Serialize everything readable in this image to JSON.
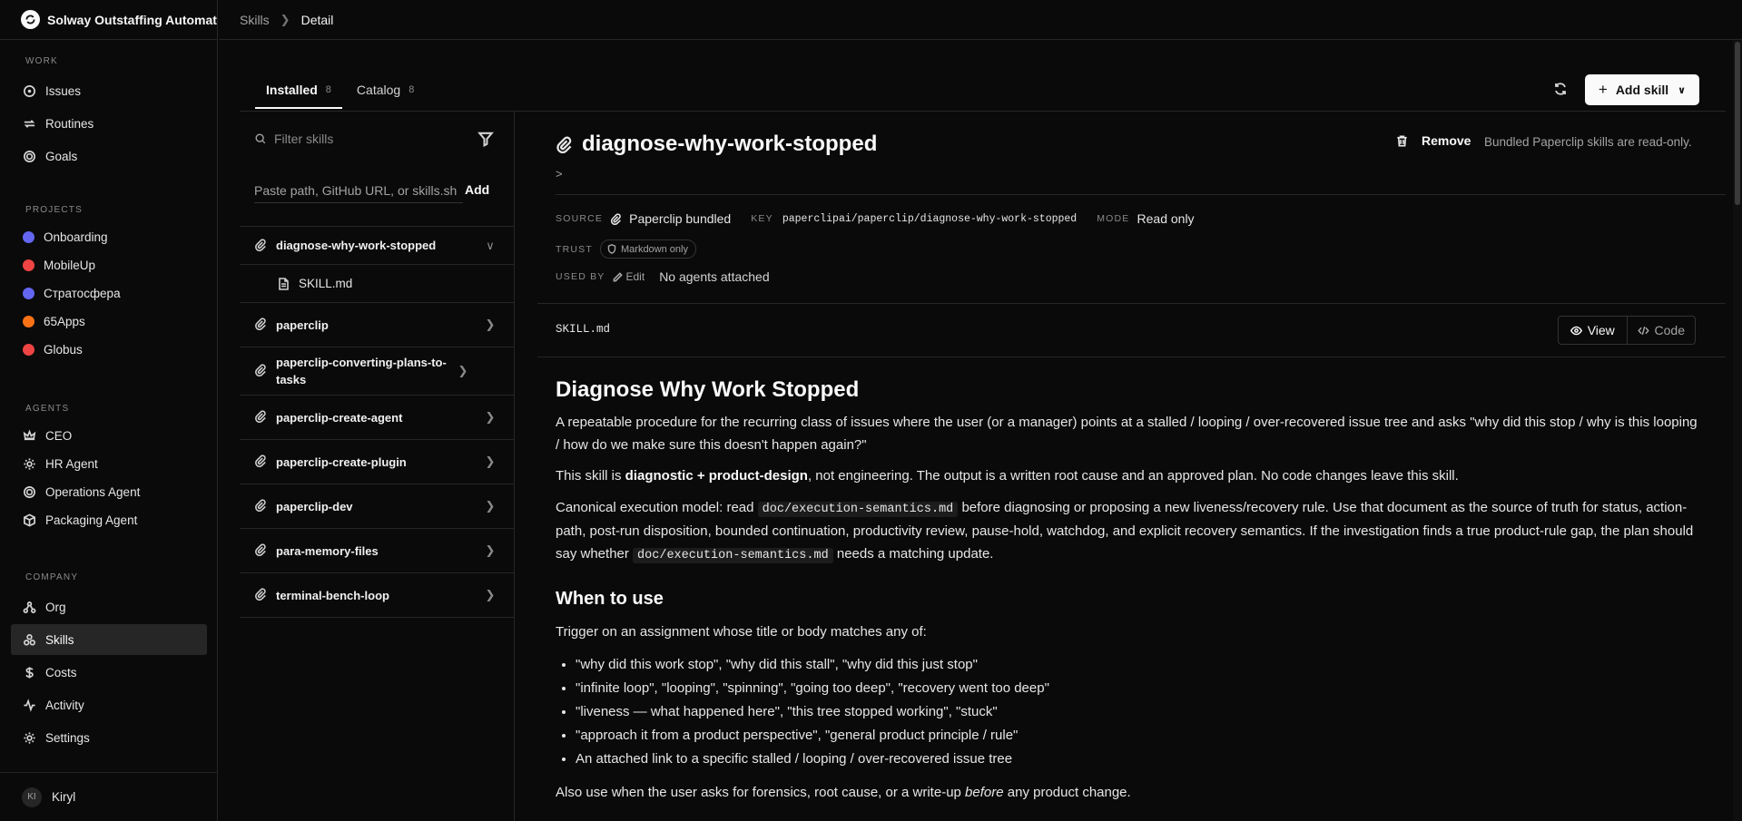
{
  "app": {
    "name": "Solway Outstaffing Automat"
  },
  "breadcrumb": {
    "parent": "Skills",
    "current": "Detail"
  },
  "sidebar": {
    "work_heading": "WORK",
    "work_items": [
      {
        "label": "Issues",
        "icon": "circle-dot-icon"
      },
      {
        "label": "Routines",
        "icon": "repeat-icon"
      },
      {
        "label": "Goals",
        "icon": "target-icon"
      }
    ],
    "projects_heading": "PROJECTS",
    "projects": [
      {
        "label": "Onboarding",
        "color": "#6366f1"
      },
      {
        "label": "MobileUp",
        "color": "#ef4444"
      },
      {
        "label": "Стратосфера",
        "color": "#6366f1"
      },
      {
        "label": "65Apps",
        "color": "#f97316"
      },
      {
        "label": "Globus",
        "color": "#ef4444"
      }
    ],
    "agents_heading": "AGENTS",
    "agents": [
      {
        "label": "CEO",
        "icon": "crown-icon"
      },
      {
        "label": "HR Agent",
        "icon": "cog-icon"
      },
      {
        "label": "Operations Agent",
        "icon": "target-icon"
      },
      {
        "label": "Packaging Agent",
        "icon": "package-icon"
      }
    ],
    "company_heading": "COMPANY",
    "company_items": [
      {
        "label": "Org",
        "icon": "org-icon"
      },
      {
        "label": "Skills",
        "icon": "skills-icon",
        "active": true
      },
      {
        "label": "Costs",
        "icon": "dollar-icon"
      },
      {
        "label": "Activity",
        "icon": "activity-icon"
      },
      {
        "label": "Settings",
        "icon": "gear-icon"
      }
    ],
    "user": {
      "initials": "KI",
      "name": "Kiryl"
    }
  },
  "tabs": [
    {
      "label": "Installed",
      "count": "8",
      "active": true
    },
    {
      "label": "Catalog",
      "count": "8",
      "active": false
    }
  ],
  "toolbar": {
    "add_skill_label": "Add skill"
  },
  "skills_pane": {
    "filter_placeholder": "Filter skills",
    "path_placeholder": "Paste path, GitHub URL, or skills.sh",
    "add_label": "Add",
    "skills": [
      {
        "name": "diagnose-why-work-stopped",
        "expanded": true,
        "files": [
          "SKILL.md"
        ]
      },
      {
        "name": "paperclip",
        "expanded": false
      },
      {
        "name": "paperclip-converting-plans-to-tasks",
        "expanded": false
      },
      {
        "name": "paperclip-create-agent",
        "expanded": false
      },
      {
        "name": "paperclip-create-plugin",
        "expanded": false
      },
      {
        "name": "paperclip-dev",
        "expanded": false
      },
      {
        "name": "para-memory-files",
        "expanded": false
      },
      {
        "name": "terminal-bench-loop",
        "expanded": false
      }
    ]
  },
  "detail": {
    "title": "diagnose-why-work-stopped",
    "prompt_glyph": ">",
    "remove_label": "Remove",
    "readonly_note": "Bundled Paperclip skills are read-only.",
    "source_label": "SOURCE",
    "source_value": "Paperclip bundled",
    "key_label": "KEY",
    "key_value": "paperclipai/paperclip/diagnose-why-work-stopped",
    "mode_label": "MODE",
    "mode_value": "Read only",
    "trust_label": "TRUST",
    "trust_value": "Markdown only",
    "used_by_label": "USED BY",
    "edit_label": "Edit",
    "used_by_value": "No agents attached",
    "file_name": "SKILL.md",
    "view_label": "View",
    "code_label": "Code"
  },
  "doc": {
    "h1": "Diagnose Why Work Stopped",
    "p1": "A repeatable procedure for the recurring class of issues where the user (or a manager) points at a stalled / looping / over-recovered issue tree and asks \"why did this stop / why is this looping / how do we make sure this doesn't happen again?\"",
    "p2_a": "This skill is ",
    "p2_b": "diagnostic + product-design",
    "p2_c": ", not engineering. The output is a written root cause and an approved plan. No code changes leave this skill.",
    "p3_a": "Canonical execution model: read ",
    "p3_code1": "doc/execution-semantics.md",
    "p3_b": " before diagnosing or proposing a new liveness/recovery rule. Use that document as the source of truth for status, action-path, post-run disposition, bounded continuation, productivity review, pause-hold, watchdog, and explicit recovery semantics. If the investigation finds a true product-rule gap, the plan should say whether ",
    "p3_code2": "doc/execution-semantics.md",
    "p3_c": " needs a matching update.",
    "h2": "When to use",
    "p4": "Trigger on an assignment whose title or body matches any of:",
    "bullets": [
      "\"why did this work stop\", \"why did this stall\", \"why did this just stop\"",
      "\"infinite loop\", \"looping\", \"spinning\", \"going too deep\", \"recovery went too deep\"",
      "\"liveness — what happened here\", \"this tree stopped working\", \"stuck\"",
      "\"approach it from a product perspective\", \"general product principle / rule\"",
      "An attached link to a specific stalled / looping / over-recovered issue tree"
    ],
    "p5_a": "Also use when the user asks for forensics, root cause, or a write-up ",
    "p5_b": "before",
    "p5_c": " any product change."
  }
}
